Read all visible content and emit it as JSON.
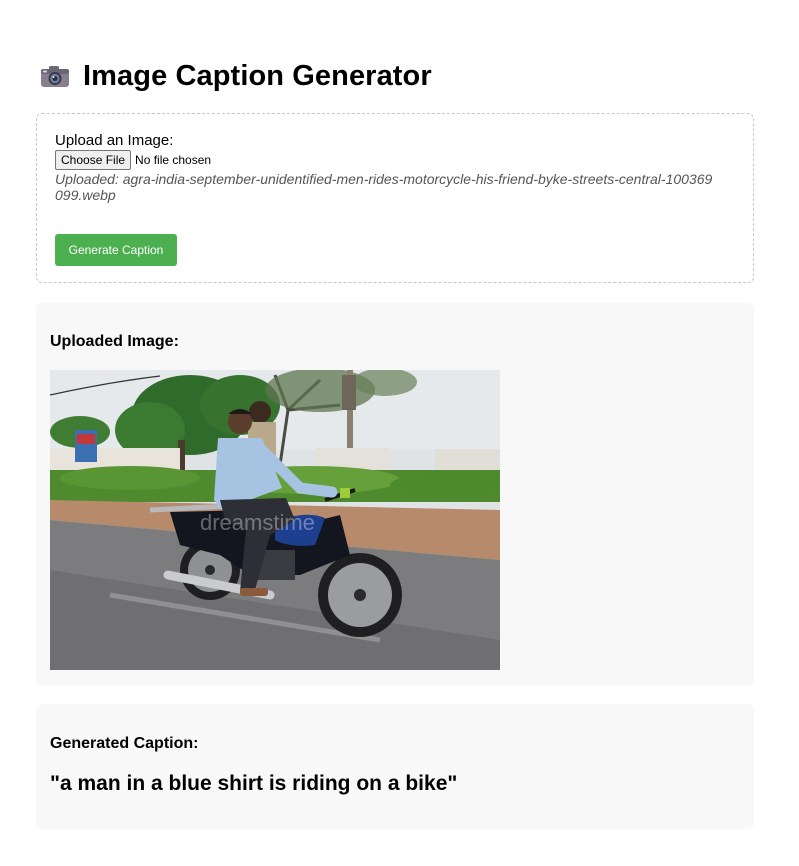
{
  "header": {
    "title": "Image Caption Generator",
    "icon": "camera-icon"
  },
  "upload": {
    "label": "Upload an Image:",
    "choose_file_label": "Choose File",
    "file_status": "No file chosen",
    "uploaded_filename": "Uploaded: agra-india-september-unidentified-men-rides-motorcycle-his-friend-byke-streets-central-100369099.webp",
    "generate_button_label": "Generate Caption"
  },
  "image_section": {
    "heading": "Uploaded Image:"
  },
  "caption_section": {
    "heading": "Generated Caption:",
    "caption": "\"a man in a blue shirt is riding on a bike\""
  },
  "colors": {
    "accent_green": "#4caf50",
    "panel_background": "#f8f8f8",
    "dashed_border": "#c8c8c8",
    "muted_text": "#555555"
  }
}
